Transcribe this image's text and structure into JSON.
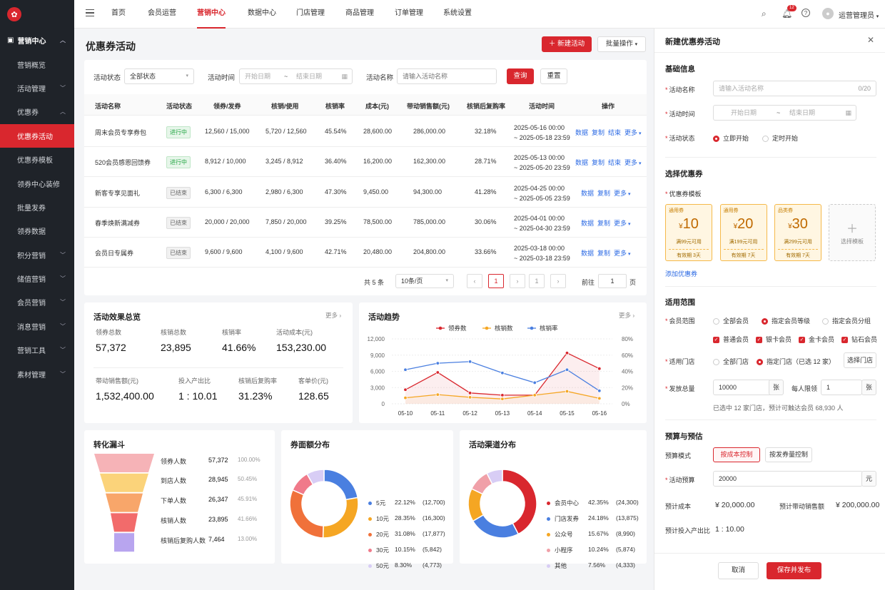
{
  "sidebar": {
    "items": [
      {
        "label": "营销中心",
        "level": "top"
      },
      {
        "label": "营销概览"
      },
      {
        "label": "活动管理"
      },
      {
        "label": "优惠券"
      },
      {
        "label": "优惠券活动",
        "selected": true
      },
      {
        "label": "优惠券模板"
      },
      {
        "label": "领券中心装修"
      },
      {
        "label": "批量发券"
      },
      {
        "label": "领券数据"
      },
      {
        "label": "积分营销"
      },
      {
        "label": "储值营销"
      },
      {
        "label": "会员营销"
      },
      {
        "label": "消息营销"
      },
      {
        "label": "营销工具"
      },
      {
        "label": "素材管理"
      }
    ]
  },
  "topnav": {
    "items": [
      "首页",
      "会员运营",
      "营销中心",
      "数据中心",
      "门店管理",
      "商品管理",
      "订单管理",
      "系统设置"
    ],
    "active": "营销中心",
    "notification_count": "12",
    "user": "运营管理员"
  },
  "page": {
    "title": "优惠券活动",
    "new_btn": "新建活动",
    "batch_btn": "批量操作"
  },
  "filters": {
    "status_label": "活动状态",
    "status_value": "全部状态",
    "time_label": "活动时间",
    "start_ph": "开始日期",
    "sep": "~",
    "end_ph": "结束日期",
    "name_label": "活动名称",
    "name_ph": "请输入活动名称",
    "query": "查询",
    "reset": "重置"
  },
  "table": {
    "headers": [
      "活动名称",
      "活动状态",
      "领券/发券",
      "核销/使用",
      "核销率",
      "成本(元)",
      "带动销售额(元)",
      "核销后复购率",
      "活动时间",
      "操作"
    ],
    "rows": [
      {
        "name": "周末会员专享券包",
        "status": "进行中",
        "issued": "12,560 / 15,000",
        "used": "5,720 / 12,560",
        "rate": "45.54%",
        "cost": "28,600.00",
        "sales": "286,000.00",
        "repurchase": "32.18%",
        "start": "2025-05-16 00:00",
        "end": "~ 2025-05-18 23:59",
        "ops": [
          "数据",
          "复制",
          "结束",
          "更多"
        ]
      },
      {
        "name": "520会员感恩回馈券",
        "status": "进行中",
        "issued": "8,912 / 10,000",
        "used": "3,245 / 8,912",
        "rate": "36.40%",
        "cost": "16,200.00",
        "sales": "162,300.00",
        "repurchase": "28.71%",
        "start": "2025-05-13 00:00",
        "end": "~ 2025-05-20 23:59",
        "ops": [
          "数据",
          "复制",
          "结束",
          "更多"
        ]
      },
      {
        "name": "新客专享见面礼",
        "status": "已结束",
        "issued": "6,300 / 6,300",
        "used": "2,980 / 6,300",
        "rate": "47.30%",
        "cost": "9,450.00",
        "sales": "94,300.00",
        "repurchase": "41.28%",
        "start": "2025-04-25 00:00",
        "end": "~ 2025-05-05 23:59",
        "ops": [
          "数据",
          "复制",
          "更多"
        ]
      },
      {
        "name": "春季焕新满减券",
        "status": "已结束",
        "issued": "20,000 / 20,000",
        "used": "7,850 / 20,000",
        "rate": "39.25%",
        "cost": "78,500.00",
        "sales": "785,000.00",
        "repurchase": "30.06%",
        "start": "2025-04-01 00:00",
        "end": "~ 2025-04-30 23:59",
        "ops": [
          "数据",
          "复制",
          "更多"
        ]
      },
      {
        "name": "会员日专属券",
        "status": "已结束",
        "issued": "9,600 / 9,600",
        "used": "4,100 / 9,600",
        "rate": "42.71%",
        "cost": "20,480.00",
        "sales": "204,800.00",
        "repurchase": "33.66%",
        "start": "2025-03-18 00:00",
        "end": "~ 2025-03-18 23:59",
        "ops": [
          "数据",
          "复制",
          "更多"
        ]
      }
    ],
    "total": "共 5 条",
    "page_size": "10条/页",
    "current_page": "1",
    "goto_label": "前往",
    "goto_value": "1",
    "goto_unit": "页"
  },
  "overview": {
    "title": "活动效果总览",
    "more": "更多",
    "metrics": [
      {
        "label": "领券总数",
        "value": "57,372"
      },
      {
        "label": "核销总数",
        "value": "23,895"
      },
      {
        "label": "核销率",
        "value": "41.66%"
      },
      {
        "label": "活动成本(元)",
        "value": "153,230.00"
      },
      {
        "label": "带动销售额(元)",
        "value": "1,532,400.00"
      },
      {
        "label": "投入产出比",
        "value": "1 : 10.01"
      },
      {
        "label": "核销后复购率",
        "value": "31.23%"
      },
      {
        "label": "客单价(元)",
        "value": "128.65"
      }
    ]
  },
  "trend": {
    "title": "活动趋势",
    "more": "更多"
  },
  "chart_data": [
    {
      "type": "line",
      "title": "活动趋势",
      "x": [
        "05-10",
        "05-11",
        "05-12",
        "05-13",
        "05-14",
        "05-15",
        "05-16"
      ],
      "series": [
        {
          "name": "领券数",
          "axis": "left",
          "color": "#d9272e",
          "values": [
            2600,
            5800,
            2000,
            1600,
            1600,
            9400,
            6500
          ]
        },
        {
          "name": "核销数",
          "axis": "left",
          "color": "#f5a623",
          "values": [
            1100,
            1700,
            1200,
            900,
            1600,
            2300,
            1000
          ]
        },
        {
          "name": "核销率",
          "axis": "right",
          "color": "#4a7fe0",
          "values": [
            42,
            50,
            52,
            38,
            26,
            42,
            16
          ]
        }
      ],
      "ylim_left": [
        0,
        12000
      ],
      "yticks_left": [
        "0",
        "3,000",
        "6,000",
        "9,000",
        "12,000"
      ],
      "ylim_right": [
        0,
        80
      ],
      "yticks_right": [
        "0%",
        "20%",
        "40%",
        "60%",
        "80%"
      ],
      "legend": "top-center",
      "grid": true
    },
    {
      "type": "pie",
      "title": "券面额分布",
      "categories": [
        "5元",
        "10元",
        "20元",
        "30元",
        "50元"
      ],
      "values": [
        22.12,
        28.35,
        31.08,
        10.15,
        8.3
      ],
      "colors": [
        "#4a7fe0",
        "#f5a623",
        "#f0713a",
        "#f07a8a",
        "#d8cdf5"
      ]
    },
    {
      "type": "pie",
      "title": "活动渠道分布",
      "categories": [
        "会员中心",
        "门店发券",
        "公众号",
        "小程序",
        "其他"
      ],
      "values": [
        42.35,
        24.18,
        15.67,
        10.24,
        7.56
      ],
      "colors": [
        "#d9272e",
        "#4a7fe0",
        "#f5a623",
        "#f0a0a8",
        "#d8cdf5"
      ]
    },
    {
      "type": "funnel",
      "title": "转化漏斗",
      "categories": [
        "领券人数",
        "到店人数",
        "下单人数",
        "核销人数",
        "核销后复购人数"
      ],
      "values": [
        57372,
        28945,
        26347,
        23895,
        7464
      ]
    }
  ],
  "funnel": {
    "title": "转化漏斗",
    "rows": [
      {
        "label": "领券人数",
        "value": "57,372",
        "pct": "100.00%",
        "color": "#f6b3b7"
      },
      {
        "label": "到店人数",
        "value": "28,945",
        "pct": "50.45%",
        "color": "#fbd37a"
      },
      {
        "label": "下单人数",
        "value": "26,347",
        "pct": "45.91%",
        "color": "#f8a66a"
      },
      {
        "label": "核销人数",
        "value": "23,895",
        "pct": "41.66%",
        "color": "#f26b6b"
      },
      {
        "label": "核销后复购人数",
        "value": "7,464",
        "pct": "13.00%",
        "color": "#b8a5ef"
      }
    ]
  },
  "face": {
    "title": "券面额分布",
    "rows": [
      {
        "label": "5元",
        "pct": "22.12%",
        "cnt": "(12,700)"
      },
      {
        "label": "10元",
        "pct": "28.35%",
        "cnt": "(16,300)"
      },
      {
        "label": "20元",
        "pct": "31.08%",
        "cnt": "(17,877)"
      },
      {
        "label": "30元",
        "pct": "10.15%",
        "cnt": "(5,842)"
      },
      {
        "label": "50元",
        "pct": "8.30%",
        "cnt": "(4,773)"
      }
    ]
  },
  "channel": {
    "title": "活动渠道分布",
    "rows": [
      {
        "label": "会员中心",
        "pct": "42.35%",
        "cnt": "(24,300)"
      },
      {
        "label": "门店发券",
        "pct": "24.18%",
        "cnt": "(13,875)"
      },
      {
        "label": "公众号",
        "pct": "15.67%",
        "cnt": "(8,990)"
      },
      {
        "label": "小程序",
        "pct": "10.24%",
        "cnt": "(5,874)"
      },
      {
        "label": "其他",
        "pct": "7.56%",
        "cnt": "(4,333)"
      }
    ]
  },
  "drawer": {
    "title": "新建优惠券活动",
    "basic": "基础信息",
    "name_label": "活动名称",
    "name_ph": "请输入活动名称",
    "name_count": "0/20",
    "time_label": "活动时间",
    "start_ph": "开始日期",
    "sep": "~",
    "end_ph": "结束日期",
    "status_label": "活动状态",
    "status_now": "立即开始",
    "status_timed": "定时开始",
    "coupon_sec": "选择优惠券",
    "tpl_label": "优惠券模板",
    "coupons": [
      {
        "type": "通用券",
        "symbol": "¥",
        "value": "10",
        "cond": "满99元可用",
        "valid": "有效期 3天"
      },
      {
        "type": "通用券",
        "symbol": "¥",
        "value": "20",
        "cond": "满199元可用",
        "valid": "有效期 7天"
      },
      {
        "type": "品类券",
        "symbol": "¥",
        "value": "30",
        "cond": "满299元可用",
        "valid": "有效期 7天"
      }
    ],
    "pick_tpl": "选择模板",
    "add_coupon": "添加优惠券",
    "scope_sec": "适用范围",
    "member_label": "会员范围",
    "m_all": "全部会员",
    "m_level": "指定会员等级",
    "m_group": "指定会员分组",
    "levels": [
      "普通会员",
      "银卡会员",
      "金卡会员",
      "钻石会员"
    ],
    "store_label": "适用门店",
    "s_all": "全部门店",
    "s_spec": "指定门店（已选 12 家）",
    "s_pick": "选择门店",
    "total_label": "发放总量",
    "total_value": "10000",
    "total_unit": "张",
    "limit_label": "每人限领",
    "limit_value": "1",
    "limit_unit": "张",
    "summary": "已选中 12 家门店，预计可触达会员 68,930 人",
    "budget_sec": "预算与预估",
    "mode_label": "预算模式",
    "mode_cost": "按成本控制",
    "mode_qty": "按发券量控制",
    "budget_label": "活动预算",
    "budget_value": "20000",
    "budget_unit": "元",
    "est_cost_label": "预计成本",
    "est_cost": "¥ 20,000.00",
    "est_sales_label": "预计带动销售额",
    "est_sales": "¥ 200,000.00",
    "roi_label": "预计投入产出比",
    "roi": "1 : 10.00",
    "cancel": "取消",
    "save": "保存并发布"
  }
}
